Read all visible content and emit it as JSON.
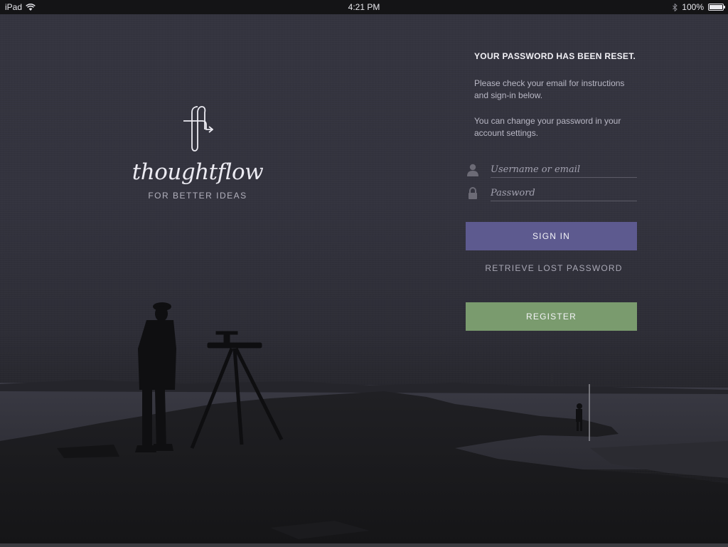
{
  "status_bar": {
    "device": "iPad",
    "time": "4:21 PM",
    "battery": "100%",
    "battery_level": 1.0
  },
  "brand": {
    "name": "thoughtflow",
    "tagline": "FOR BETTER IDEAS",
    "logo_icon": "thoughtflow-logo-icon"
  },
  "panel": {
    "heading": "YOUR PASSWORD HAS BEEN RESET.",
    "message_1": "Please check your email for instructions and sign-in below.",
    "message_2": "You can change your password in your account settings.",
    "username_placeholder": "Username or email",
    "username_value": "",
    "password_placeholder": "Password",
    "password_value": "",
    "signin_label": "SIGN IN",
    "retrieve_label": "RETRIEVE LOST PASSWORD",
    "register_label": "REGISTER"
  },
  "colors": {
    "signin_button": "#5d5a8f",
    "register_button": "#7a9b6e",
    "background": "#33333e"
  }
}
